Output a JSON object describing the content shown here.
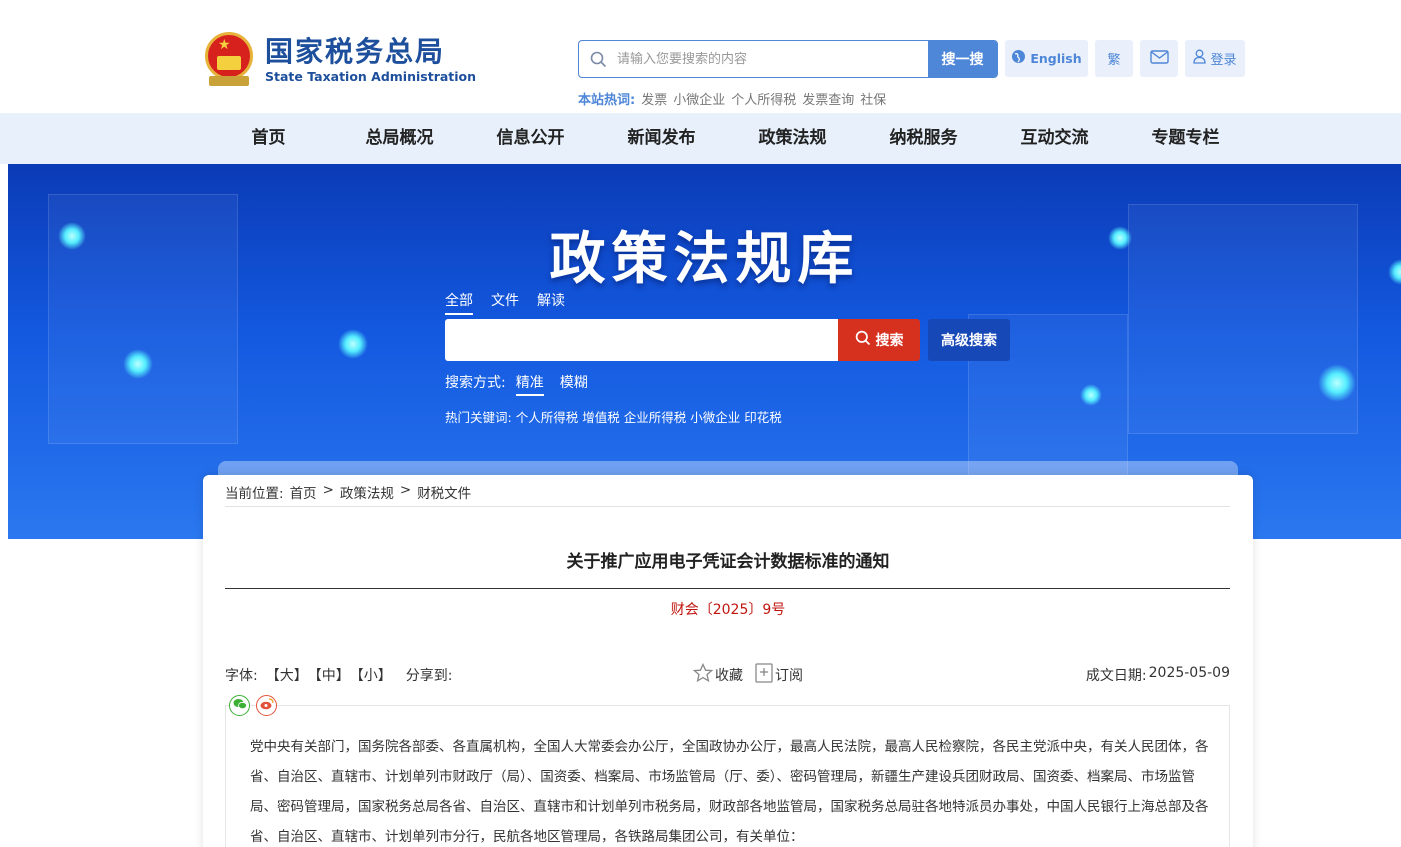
{
  "header": {
    "logo_cn": "国家税务总局",
    "logo_en": "State Taxation Administration",
    "search_placeholder": "请输入您要搜索的内容",
    "search_button": "搜一搜",
    "english_label": "English",
    "traditional_label": "繁",
    "login_label": "登录",
    "hot_label": "本站热词:",
    "hot_words": [
      "发票",
      "小微企业",
      "个人所得税",
      "发票查询",
      "社保"
    ]
  },
  "nav": {
    "items": [
      "首页",
      "总局概况",
      "信息公开",
      "新闻发布",
      "政策法规",
      "纳税服务",
      "互动交流",
      "专题专栏"
    ]
  },
  "banner": {
    "title": "政策法规库",
    "scope_tabs": [
      "全部",
      "文件",
      "解读"
    ],
    "search_button": "搜索",
    "advanced_search": "高级搜索",
    "mode_label": "搜索方式:",
    "modes": [
      "精准",
      "模糊"
    ],
    "hot_keywords_label": "热门关键词:",
    "hot_keywords": [
      "个人所得税",
      "增值税",
      "企业所得税",
      "小微企业",
      "印花税"
    ]
  },
  "article": {
    "breadcrumb_label": "当前位置:",
    "breadcrumb": [
      "首页",
      "政策法规",
      "财税文件"
    ],
    "breadcrumb_sep": ">",
    "title": "关于推广应用电子凭证会计数据标准的通知",
    "doc_number": "财会〔2025〕9号",
    "font_label": "字体:",
    "font_sizes": [
      "【大】",
      "【中】",
      "【小】"
    ],
    "share_label": "分享到:",
    "collect_label": "收藏",
    "subscribe_label": "订阅",
    "date_label": "成文日期:",
    "date": "2025-05-09",
    "body": "党中央有关部门，国务院各部委、各直属机构，全国人大常委会办公厅，全国政协办公厅，最高人民法院，最高人民检察院，各民主党派中央，有关人民团体，各省、自治区、直辖市、计划单列市财政厅（局）、国资委、档案局、市场监管局（厅、委）、密码管理局，新疆生产建设兵团财政局、国资委、档案局、市场监管局、密码管理局，国家税务总局各省、自治区、直辖市和计划单列市税务局，财政部各地监管局，国家税务总局驻各地特派员办事处，中国人民银行上海总部及各省、自治区、直辖市、计划单列市分行，民航各地区管理局，各铁路局集团公司，有关单位："
  },
  "colors": {
    "brand_blue": "#1d4f9c",
    "accent_blue": "#4e86d8",
    "search_red": "#d6301f",
    "doc_number_red": "#c0150f"
  }
}
